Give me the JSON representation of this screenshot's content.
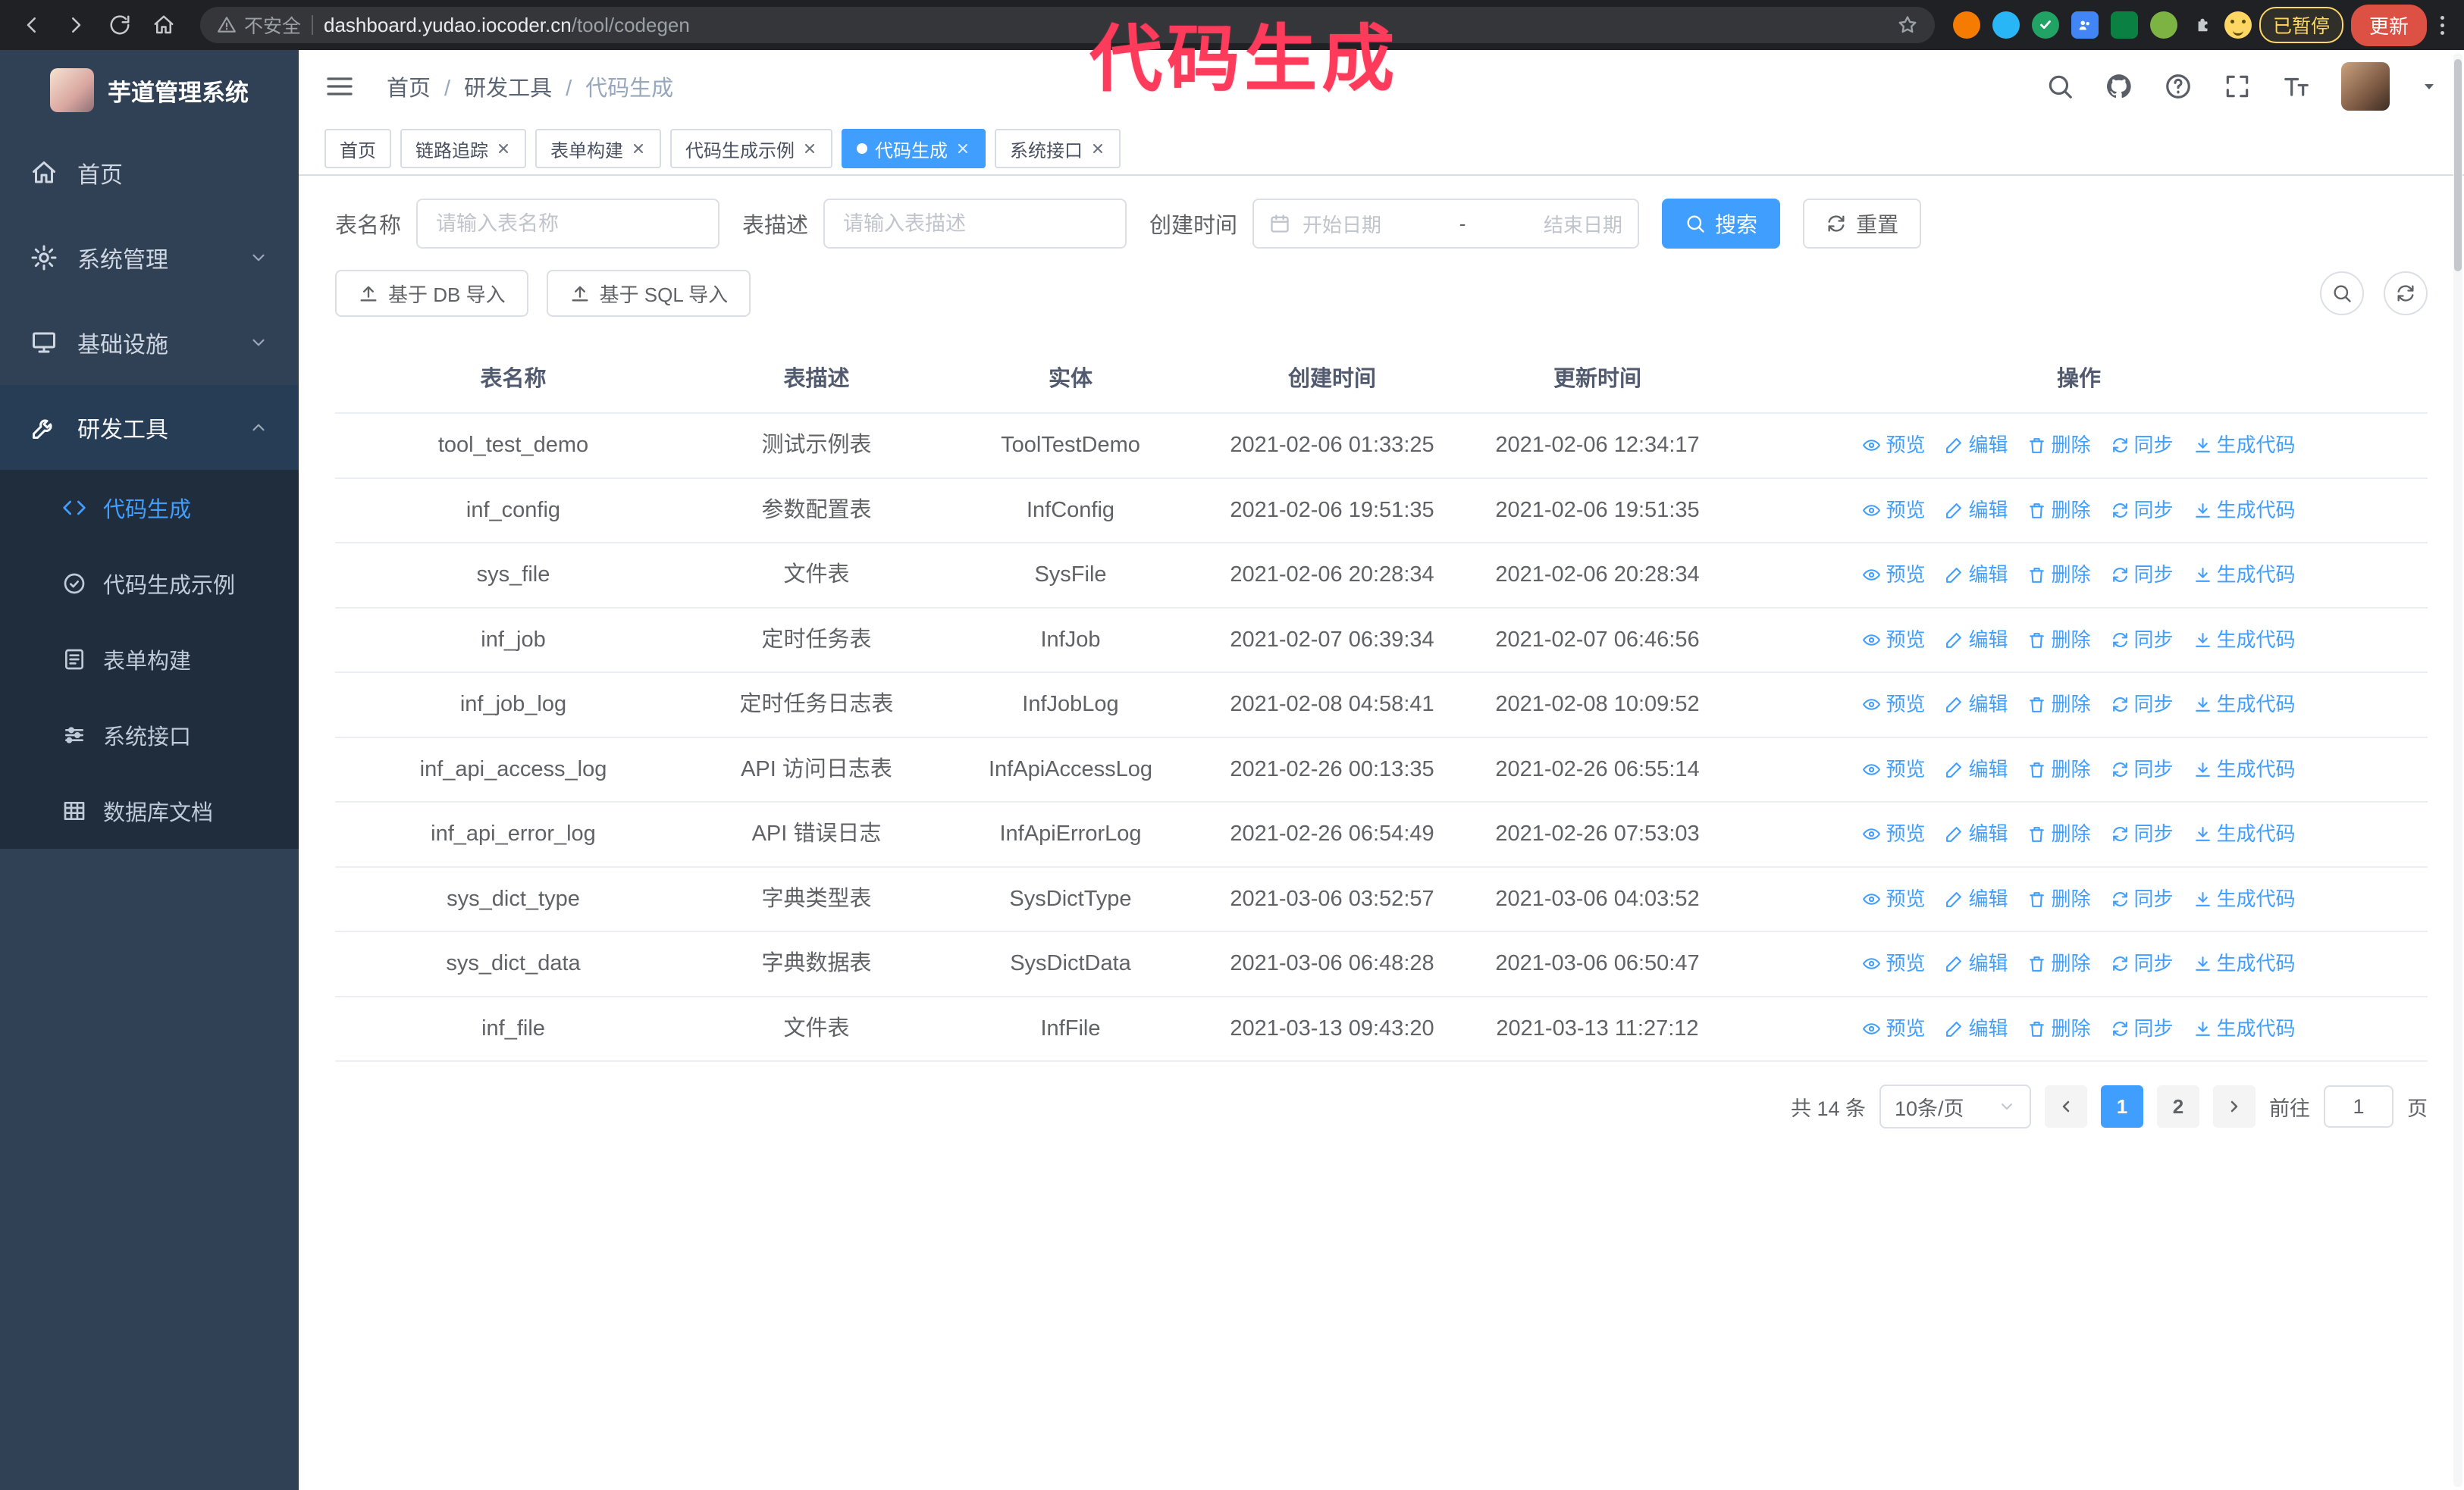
{
  "browser": {
    "security_label": "不安全",
    "url_host": "dashboard.yudao.iocoder.cn",
    "url_path": "/tool/codegen",
    "paused_badge": "已暂停",
    "update_button": "更新"
  },
  "annotation": {
    "text": "代码生成"
  },
  "sidebar": {
    "logo_title": "芋道管理系统",
    "items": [
      {
        "label": "首页"
      },
      {
        "label": "系统管理"
      },
      {
        "label": "基础设施"
      },
      {
        "label": "研发工具"
      }
    ],
    "subitems": [
      {
        "label": "代码生成"
      },
      {
        "label": "代码生成示例"
      },
      {
        "label": "表单构建"
      },
      {
        "label": "系统接口"
      },
      {
        "label": "数据库文档"
      }
    ]
  },
  "header": {
    "breadcrumb": [
      "首页",
      "研发工具",
      "代码生成"
    ]
  },
  "tabs": [
    {
      "label": "首页"
    },
    {
      "label": "链路追踪"
    },
    {
      "label": "表单构建"
    },
    {
      "label": "代码生成示例"
    },
    {
      "label": "代码生成"
    },
    {
      "label": "系统接口"
    }
  ],
  "filters": {
    "table_name_label": "表名称",
    "table_name_placeholder": "请输入表名称",
    "table_desc_label": "表描述",
    "table_desc_placeholder": "请输入表描述",
    "create_time_label": "创建时间",
    "date_start_placeholder": "开始日期",
    "date_separator": "-",
    "date_end_placeholder": "结束日期",
    "search_button": "搜索",
    "reset_button": "重置"
  },
  "toolbar": {
    "import_db": "基于 DB 导入",
    "import_sql": "基于 SQL 导入"
  },
  "table": {
    "columns": [
      "表名称",
      "表描述",
      "实体",
      "创建时间",
      "更新时间",
      "操作"
    ],
    "actions": [
      "预览",
      "编辑",
      "删除",
      "同步",
      "生成代码"
    ],
    "rows": [
      {
        "name": "tool_test_demo",
        "desc": "测试示例表",
        "entity": "ToolTestDemo",
        "created": "2021-02-06 01:33:25",
        "updated": "2021-02-06 12:34:17"
      },
      {
        "name": "inf_config",
        "desc": "参数配置表",
        "entity": "InfConfig",
        "created": "2021-02-06 19:51:35",
        "updated": "2021-02-06 19:51:35"
      },
      {
        "name": "sys_file",
        "desc": "文件表",
        "entity": "SysFile",
        "created": "2021-02-06 20:28:34",
        "updated": "2021-02-06 20:28:34"
      },
      {
        "name": "inf_job",
        "desc": "定时任务表",
        "entity": "InfJob",
        "created": "2021-02-07 06:39:34",
        "updated": "2021-02-07 06:46:56"
      },
      {
        "name": "inf_job_log",
        "desc": "定时任务日志表",
        "entity": "InfJobLog",
        "created": "2021-02-08 04:58:41",
        "updated": "2021-02-08 10:09:52"
      },
      {
        "name": "inf_api_access_log",
        "desc": "API 访问日志表",
        "entity": "InfApiAccessLog",
        "created": "2021-02-26 00:13:35",
        "updated": "2021-02-26 06:55:14"
      },
      {
        "name": "inf_api_error_log",
        "desc": "API 错误日志",
        "entity": "InfApiErrorLog",
        "created": "2021-02-26 06:54:49",
        "updated": "2021-02-26 07:53:03"
      },
      {
        "name": "sys_dict_type",
        "desc": "字典类型表",
        "entity": "SysDictType",
        "created": "2021-03-06 03:52:57",
        "updated": "2021-03-06 04:03:52"
      },
      {
        "name": "sys_dict_data",
        "desc": "字典数据表",
        "entity": "SysDictData",
        "created": "2021-03-06 06:48:28",
        "updated": "2021-03-06 06:50:47"
      },
      {
        "name": "inf_file",
        "desc": "文件表",
        "entity": "InfFile",
        "created": "2021-03-13 09:43:20",
        "updated": "2021-03-13 11:27:12"
      }
    ]
  },
  "pagination": {
    "total": "共 14 条",
    "page_size": "10条/页",
    "pages": [
      "1",
      "2"
    ],
    "active_page": "1",
    "goto_label": "前往",
    "goto_value": "1",
    "goto_suffix": "页"
  },
  "colors": {
    "accent": "#409EFF",
    "sidebar": "#304156",
    "submenu": "#1f2d3d",
    "annotation": "#ff3b5c",
    "chrome_bar": "#202124",
    "update_button": "#dd5144",
    "paused_badge": "#fdd663"
  }
}
